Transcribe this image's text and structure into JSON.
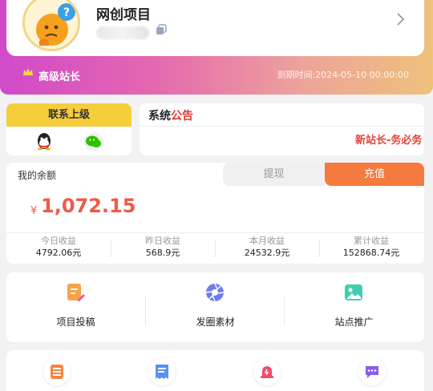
{
  "profile": {
    "name": "网创项目",
    "vip_label": "高级站长",
    "expire_text": "到期时间:2024-05-10 00:00:00"
  },
  "contact": {
    "title": "联系上级"
  },
  "notice": {
    "title_prefix": "系统",
    "title_highlight": "公告",
    "marquee": "新站长-务必务"
  },
  "balance": {
    "label": "我的余额",
    "withdraw_label": "提现",
    "recharge_label": "充值",
    "currency": "¥",
    "amount": "1,072.15",
    "stats": [
      {
        "label": "今日收益",
        "value": "4792.06元"
      },
      {
        "label": "昨日收益",
        "value": "568.9元"
      },
      {
        "label": "本月收益",
        "value": "24532.9元"
      },
      {
        "label": "累计收益",
        "value": "152868.74元"
      }
    ]
  },
  "menu": [
    {
      "label": "项目投稿",
      "icon": "document-edit-icon"
    },
    {
      "label": "发圈素材",
      "icon": "aperture-icon"
    },
    {
      "label": "站点推广",
      "icon": "image-icon"
    }
  ],
  "bottom_icons": [
    "list-icon",
    "receipt-icon",
    "alert-icon",
    "chat-icon"
  ],
  "colors": {
    "accent_orange": "#f47a3e",
    "amount_red": "#ee5a4a",
    "contact_yellow": "#f6cd3b",
    "gradient_start": "#d04ac9",
    "gradient_end": "#efc17b"
  }
}
